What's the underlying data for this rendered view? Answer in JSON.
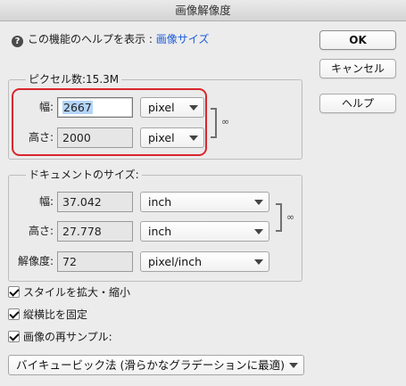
{
  "window": {
    "title": "画像解像度"
  },
  "help": {
    "prefix": "この機能のヘルプを表示 : ",
    "link": "画像サイズ",
    "icon": "question-icon"
  },
  "buttons": {
    "ok": "OK",
    "cancel": "キャンセル",
    "help": "ヘルプ"
  },
  "pixel_dimensions": {
    "legend": "ピクセル数:15.3M",
    "width_label": "幅:",
    "width_value": "2667",
    "width_unit": "pixel",
    "height_label": "高さ:",
    "height_value": "2000",
    "height_unit": "pixel",
    "highlight_color": "#d9262c"
  },
  "document_size": {
    "legend": "ドキュメントのサイズ:",
    "width_label": "幅:",
    "width_value": "37.042",
    "width_unit": "inch",
    "height_label": "高さ:",
    "height_value": "27.778",
    "height_unit": "inch",
    "resolution_label": "解像度:",
    "resolution_value": "72",
    "resolution_unit": "pixel/inch"
  },
  "options": {
    "scale_styles": {
      "label": "スタイルを拡大・縮小",
      "checked": true
    },
    "constrain_proportions": {
      "label": "縦横比を固定",
      "checked": true
    },
    "resample": {
      "label": "画像の再サンプル:",
      "checked": true
    }
  },
  "resample_method": "バイキュービック法 (滑らかなグラデーションに最適)",
  "icons": {
    "link": "chain-link-icon",
    "dropdown": "chevron-down-icon",
    "checkbox": "checkmark-icon"
  }
}
